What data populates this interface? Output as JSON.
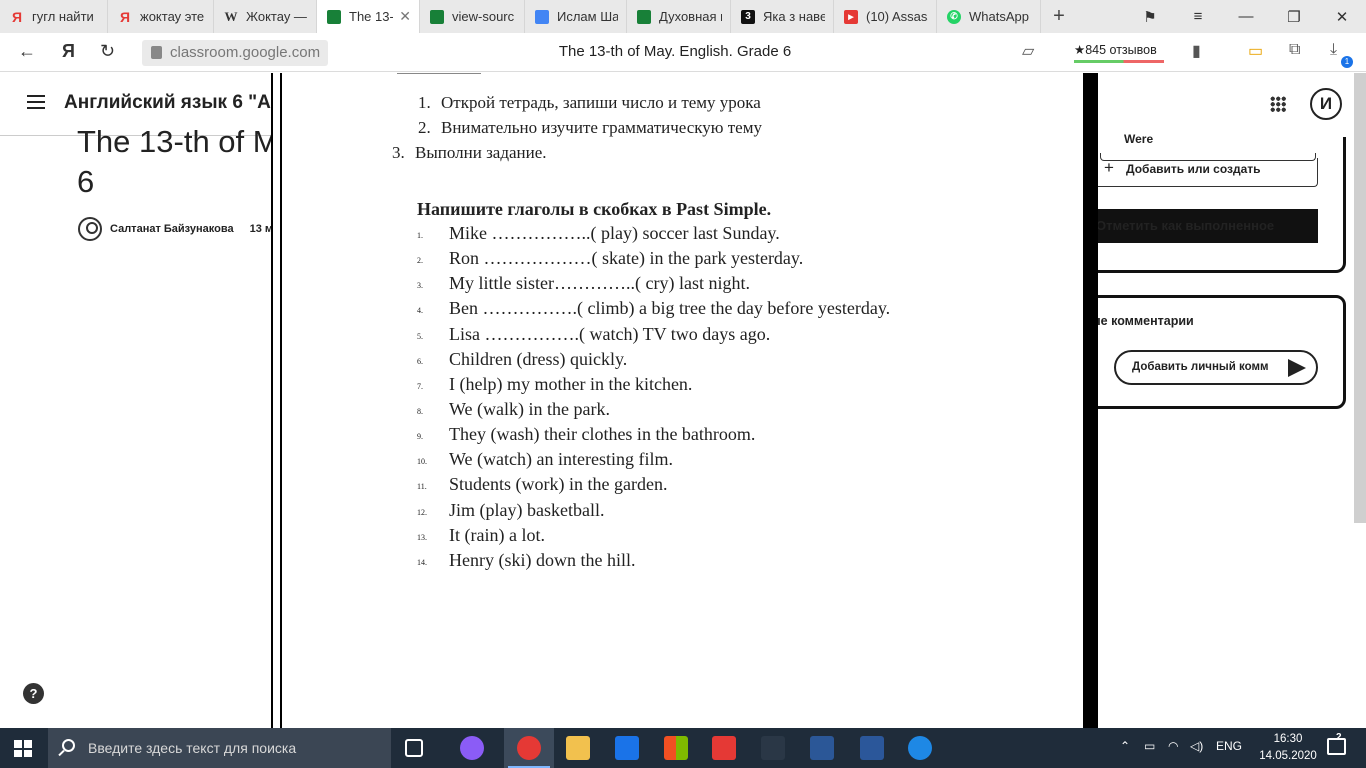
{
  "browser": {
    "tabs": [
      {
        "label": "гугл найти",
        "color": "#e53935",
        "glyph": "Я"
      },
      {
        "label": "жоктау эте",
        "color": "#e53935",
        "glyph": "Я"
      },
      {
        "label": "Жоктау —",
        "color": "#555555",
        "glyph": "W"
      },
      {
        "label": "The 13-t",
        "color": "#188038",
        "glyph": ""
      },
      {
        "label": "view-sourc",
        "color": "#188038",
        "glyph": ""
      },
      {
        "label": "Ислам Ша",
        "color": "#4285f4",
        "glyph": ""
      },
      {
        "label": "Духовная и",
        "color": "#188038",
        "glyph": ""
      },
      {
        "label": "Яка з наве,",
        "color": "#111111",
        "glyph": "3"
      },
      {
        "label": "(10) Assass",
        "color": "#e53935",
        "glyph": "▶"
      },
      {
        "label": "WhatsApp",
        "color": "#25d366",
        "glyph": "✆"
      }
    ],
    "url": "classroom.google.com",
    "page_title": "The 13-th of May. English. Grade 6",
    "reviews": "★845 отзывов",
    "downloads_badge": "1"
  },
  "classroom": {
    "course_title": "Английский язык 6 \"А",
    "assignment_title_line1": "The 13-th of M",
    "assignment_title_line2": "6",
    "author": "Салтанат Байзунакова",
    "date": "13 м",
    "help": "?",
    "user_initial": "И",
    "work_item": "Were",
    "add_or_create": "Добавить или создать",
    "mark_done": "Отметить как выполненное",
    "private_comments": "ые комментарии",
    "add_comment": "Добавить личный комм"
  },
  "document": {
    "steps": [
      {
        "num": "1.",
        "text": "Открой тетрадь, запиши число и тему урока"
      },
      {
        "num": "2.",
        "text": "Внимательно изучите грамматическую тему"
      },
      {
        "num": "3.",
        "text": "Выполни задание."
      }
    ],
    "task_heading": "Напишите глаголы в скобках в Past Simple.",
    "exercises": [
      {
        "num": "1.",
        "text": "Mike ……………..( play) soccer last Sunday."
      },
      {
        "num": "2.",
        "text": "Ron ………………( skate) in the park yesterday."
      },
      {
        "num": "3.",
        "text": "My little sister…………..( cry) last night."
      },
      {
        "num": "4.",
        "text": "Ben …………….( climb) a big tree the day before yesterday."
      },
      {
        "num": "5.",
        "text": "Lisa …………….( watch) TV  two days ago."
      },
      {
        "num": "6.",
        "text": "Children (dress) quickly."
      },
      {
        "num": "7.",
        "text": "I (help) my mother in the kitchen."
      },
      {
        "num": "8.",
        "text": "We (walk) in the park."
      },
      {
        "num": "9.",
        "text": "They (wash) their clothes in the bathroom."
      },
      {
        "num": "10.",
        "text": "We (watch) an interesting film."
      },
      {
        "num": "11.",
        "text": "Students (work) in the garden."
      },
      {
        "num": "12.",
        "text": "Jim (play) basketball."
      },
      {
        "num": "13.",
        "text": "It (rain) a lot."
      },
      {
        "num": "14.",
        "text": "Henry (ski) down the hill."
      }
    ]
  },
  "taskbar": {
    "search_placeholder": "Введите здесь текст для поиска",
    "language": "ENG",
    "time": "16:30",
    "date": "14.05.2020",
    "notifications": "2"
  }
}
